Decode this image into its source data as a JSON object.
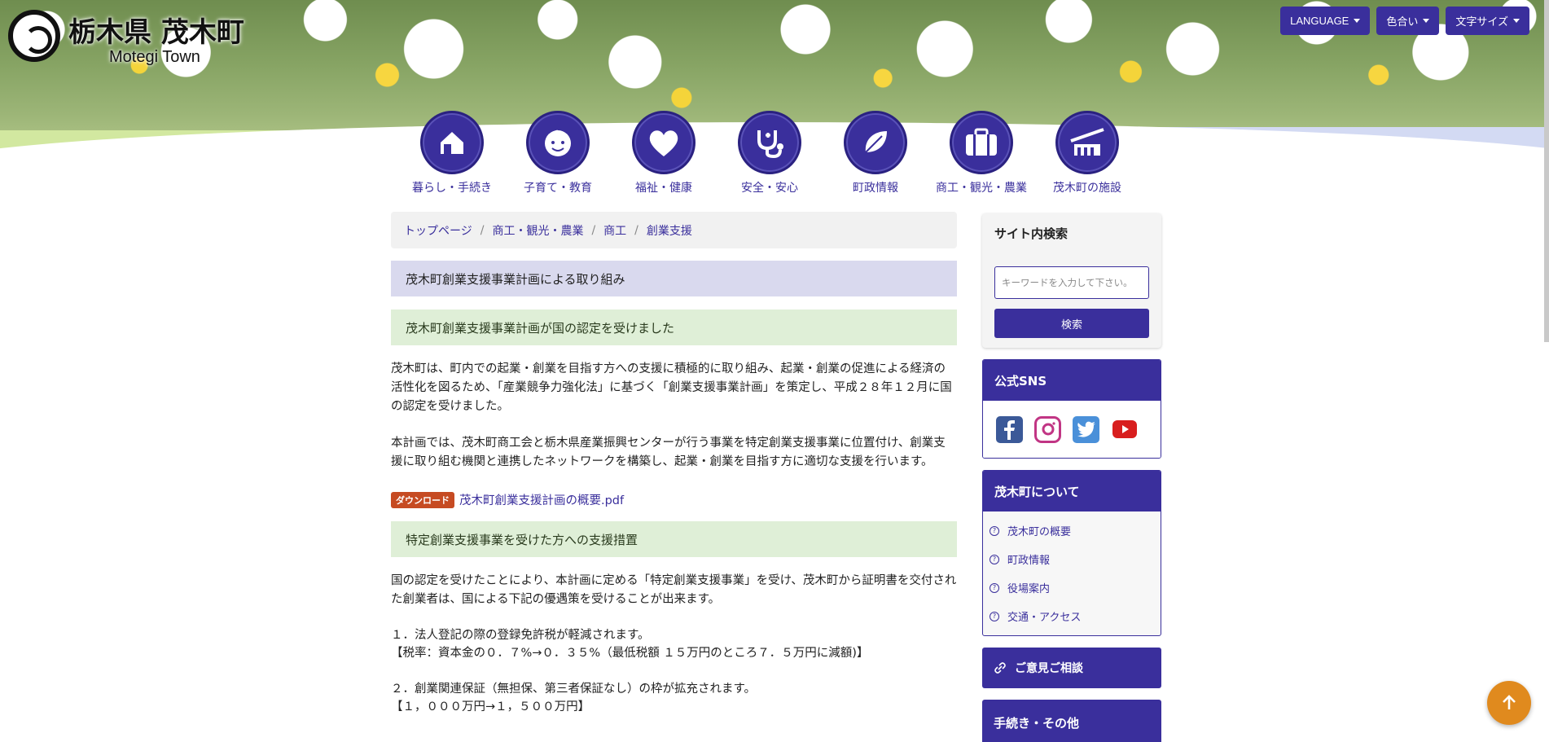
{
  "header": {
    "title": "栃木県 茂木町",
    "subtitle": "Motegi Town",
    "buttons": [
      {
        "label": "LANGUAGE"
      },
      {
        "label": "色合い"
      },
      {
        "label": "文字サイズ"
      }
    ]
  },
  "nav": {
    "items": [
      {
        "label": "暮らし・手続き",
        "icon": "house-icon"
      },
      {
        "label": "子育て・教育",
        "icon": "baby-face-icon"
      },
      {
        "label": "福祉・健康",
        "icon": "heart-icon"
      },
      {
        "label": "安全・安心",
        "icon": "stethoscope-icon"
      },
      {
        "label": "町政情報",
        "icon": "leaf-icon"
      },
      {
        "label": "商工・観光・農業",
        "icon": "suitcase-icon"
      },
      {
        "label": "茂木町の施設",
        "icon": "building-icon"
      }
    ]
  },
  "breadcrumb": {
    "items": [
      "トップページ",
      "商工・観光・農業",
      "商工",
      "創業支援"
    ]
  },
  "content": {
    "h2": "茂木町創業支援事業計画による取り組み",
    "h3_1": "茂木町創業支援事業計画が国の認定を受けました",
    "p1": "茂木町は、町内での起業・創業を目指す方への支援に積極的に取り組み、起業・創業の促進による経済の活性化を図るため、「産業競争力強化法」に基づく「創業支援事業計画」を策定し、平成２８年１２月に国の認定を受けました。",
    "p2": "本計画では、茂木町商工会と栃木県産業振興センターが行う事業を特定創業支援事業に位置付け、創業支援に取り組む機関と連携したネットワークを構築し、起業・創業を目指す方に適切な支援を行います。",
    "download_badge": "ダウンロード",
    "download_link": "茂木町創業支援計画の概要.pdf",
    "h3_2": "特定創業支援事業を受けた方への支援措置",
    "p3": "国の認定を受けたことにより、本計画に定める「特定創業支援事業」を受け、茂木町から証明書を交付された創業者は、国による下記の優遇策を受けることが出来ます。",
    "item1_title": "１．法人登記の際の登録免許税が軽減されます。",
    "item1_detail": "【税率：資本金の０．７%→０．３５%（最低税額 １５万円のところ７．５万円に減額)】",
    "item2_title": "２．創業関連保証（無担保、第三者保証なし）の枠が拡充されます。",
    "item2_detail": "【１，０００万円→１，５００万円】"
  },
  "sidebar": {
    "search_title": "サイト内検索",
    "search_placeholder": "キーワードを入力して下さい。",
    "search_button": "検索",
    "sns_title": "公式SNS",
    "sns": [
      "facebook-icon",
      "instagram-icon",
      "twitter-icon",
      "youtube-icon"
    ],
    "about_title": "茂木町について",
    "about_items": [
      "茂木町の概要",
      "町政情報",
      "役場案内",
      "交通・アクセス"
    ],
    "consult_label": "ご意見ご相談",
    "procedures_title": "手続き・その他"
  },
  "colors": {
    "primary": "#3a2f9c",
    "accent_green": "#dfefd7",
    "accent_lavender": "#d9d9ee",
    "badge": "#c64b22",
    "back_to_top": "#e08a1e"
  }
}
